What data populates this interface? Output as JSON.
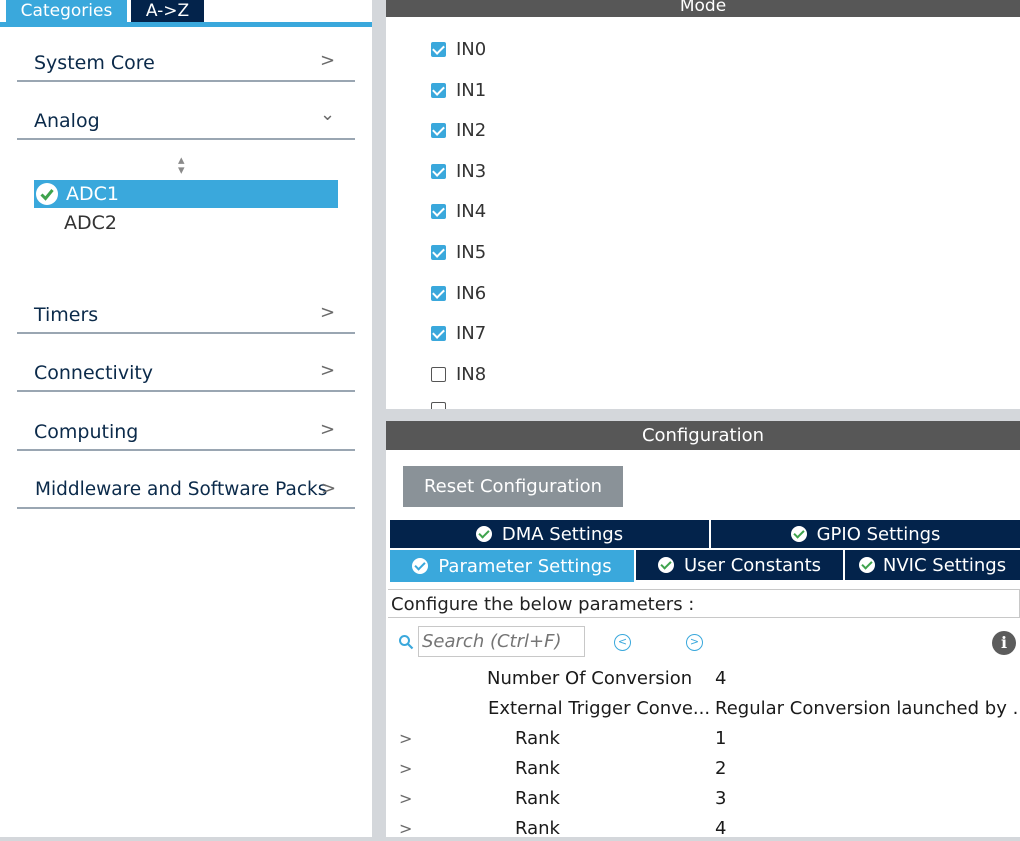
{
  "left_tabs": {
    "categories": "Categories",
    "a_to_z": "A->Z"
  },
  "categories": [
    {
      "label": "System Core",
      "chevron": ">"
    },
    {
      "label": "Analog",
      "chevron": "⌄"
    },
    {
      "label": "Timers",
      "chevron": ">"
    },
    {
      "label": "Connectivity",
      "chevron": ">"
    },
    {
      "label": "Computing",
      "chevron": ">"
    },
    {
      "label": "Middleware and Software Packs",
      "chevron": ">"
    }
  ],
  "analog_items": [
    {
      "label": "ADC1",
      "selected": true
    },
    {
      "label": "ADC2",
      "selected": false
    }
  ],
  "mode": {
    "title": "Mode",
    "channels": [
      {
        "label": "IN0",
        "checked": true
      },
      {
        "label": "IN1",
        "checked": true
      },
      {
        "label": "IN2",
        "checked": true
      },
      {
        "label": "IN3",
        "checked": true
      },
      {
        "label": "IN4",
        "checked": true
      },
      {
        "label": "IN5",
        "checked": true
      },
      {
        "label": "IN6",
        "checked": true
      },
      {
        "label": "IN7",
        "checked": true
      },
      {
        "label": "IN8",
        "checked": false
      }
    ]
  },
  "configuration": {
    "title": "Configuration",
    "reset_label": "Reset Configuration",
    "tabs": {
      "dma": "DMA Settings",
      "gpio": "GPIO Settings",
      "parameter": "Parameter Settings",
      "user_constants": "User Constants",
      "nvic": "NVIC Settings"
    },
    "description": "Configure the below parameters :",
    "search_placeholder": "Search (Ctrl+F)",
    "params": [
      {
        "name": "Number Of Conversion",
        "value": "4"
      },
      {
        "name": "External Trigger Conve...",
        "value": "Regular Conversion launched by ..."
      }
    ],
    "ranks": [
      {
        "name": "Rank",
        "value": "1"
      },
      {
        "name": "Rank",
        "value": "2"
      },
      {
        "name": "Rank",
        "value": "3"
      },
      {
        "name": "Rank",
        "value": "4"
      }
    ]
  },
  "colors": {
    "accent": "#3aa8dc",
    "navy": "#03234b",
    "header_gray": "#575757"
  }
}
